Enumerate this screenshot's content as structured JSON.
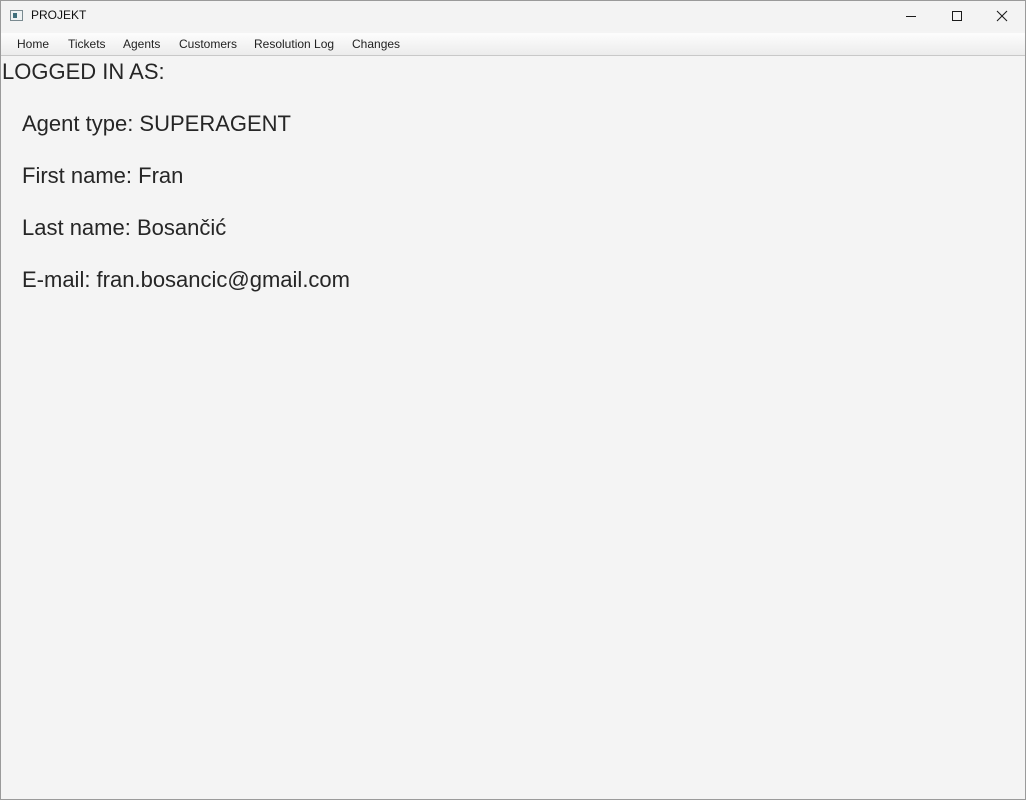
{
  "window": {
    "title": "PROJEKT",
    "icons": {
      "app": "app-window-icon",
      "minimize": "minimize-icon",
      "maximize": "maximize-icon",
      "close": "close-icon"
    }
  },
  "menu": {
    "items": [
      {
        "label": "Home"
      },
      {
        "label": "Tickets"
      },
      {
        "label": "Agents"
      },
      {
        "label": "Customers"
      },
      {
        "label": "Resolution Log"
      },
      {
        "label": "Changes"
      }
    ]
  },
  "main": {
    "heading": "LOGGED IN AS:",
    "agent_type": {
      "label": "Agent type",
      "value": "SUPERAGENT",
      "text": "Agent type: SUPERAGENT"
    },
    "first_name": {
      "label": "First name",
      "value": "Fran",
      "text": "First name: Fran"
    },
    "last_name": {
      "label": "Last name",
      "value": "Bosančić",
      "text": "Last name: Bosančić"
    },
    "email": {
      "label": "E-mail",
      "value": "fran.bosancic@gmail.com",
      "text": "E-mail: fran.bosancic@gmail.com"
    }
  },
  "colors": {
    "background": "#f4f4f4",
    "text": "#262626",
    "titlebar": "#f3f3f3"
  }
}
